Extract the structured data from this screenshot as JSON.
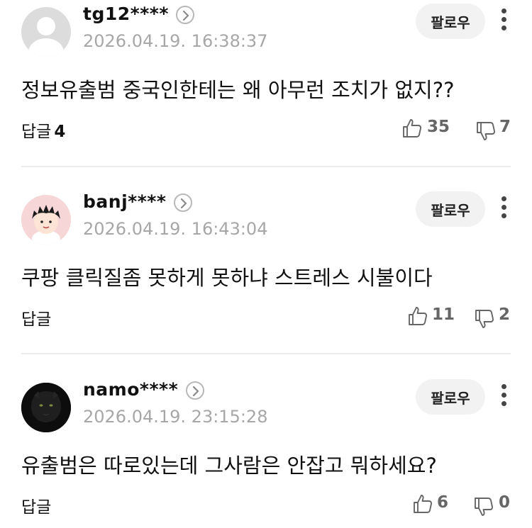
{
  "comments": [
    {
      "username": "tg12****",
      "timestamp": "2026.04.19. 16:38:37",
      "follow_label": "팔로우",
      "text": "정보유출범 중국인한테는 왜 아무런 조치가 없지??",
      "reply_label": "답글",
      "reply_count": "4",
      "likes": "35",
      "dislikes": "7",
      "avatar": "default-profile-icon"
    },
    {
      "username": "banj****",
      "timestamp": "2026.04.19. 16:43:04",
      "follow_label": "팔로우",
      "text": "쿠팡 클릭질좀 못하게 못하냐 스트레스 시불이다",
      "reply_label": "답글",
      "reply_count": "",
      "likes": "11",
      "dislikes": "2",
      "avatar": "cartoon-boy-avatar"
    },
    {
      "username": "namo****",
      "timestamp": "2026.04.19. 23:15:28",
      "follow_label": "팔로우",
      "text": "유출범은 따로있는데 그사람은 안잡고 뭐하세요?",
      "reply_label": "답글",
      "reply_count": "",
      "likes": "6",
      "dislikes": "0",
      "avatar": "black-panther-avatar"
    }
  ],
  "colors": {
    "text": "#111111",
    "muted": "#a7a7a7",
    "count": "#666666",
    "button_bg": "#f2f2f2",
    "divider": "#ececec"
  }
}
